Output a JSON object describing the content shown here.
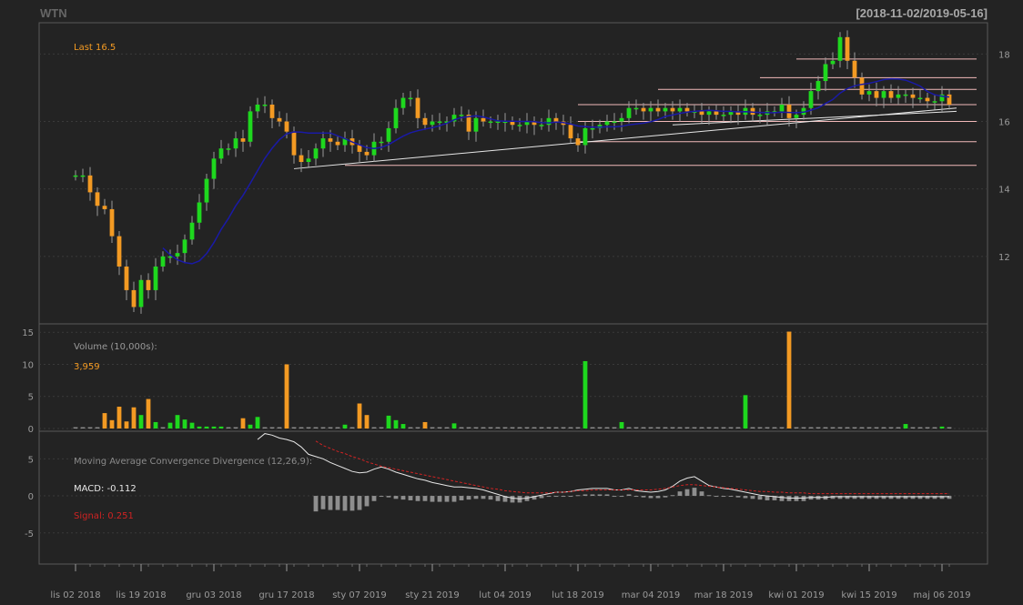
{
  "header": {
    "symbol": "WTN",
    "range": "[2018-11-02/2019-05-16]"
  },
  "colors": {
    "background": "#232323",
    "up": "#1ed81e",
    "down": "#f39a23",
    "ma": "#1a1aa6",
    "level": "#f2b9b9",
    "trend": "#e6e6e6",
    "macd": "#e6e6e6",
    "signal": "#d02323",
    "hist": "#8e8e8e",
    "text": "#9a9a9a",
    "accent": "#f39a23"
  },
  "chart_data": [
    {
      "type": "candlestick",
      "panel": "price",
      "last_label": "Last 16.5",
      "y_ticks": [
        12,
        14,
        16,
        18
      ],
      "ylim": [
        10.0,
        18.9
      ],
      "x_tick_labels": [
        "lis 02 2018",
        "lis 19 2018",
        "gru 03 2018",
        "gru 17 2018",
        "sty 07 2019",
        "sty 21 2019",
        "lut 04 2019",
        "lut 18 2019",
        "mar 04 2019",
        "mar 18 2019",
        "kwi 01 2019",
        "kwi 15 2019",
        "maj 06 2019"
      ],
      "x_tick_index": [
        0,
        9,
        19,
        29,
        39,
        49,
        59,
        69,
        79,
        89,
        99,
        109,
        119
      ],
      "n_bars": 121,
      "close": [
        14.4,
        14.4,
        13.9,
        13.5,
        13.4,
        12.6,
        11.7,
        11.0,
        10.5,
        11.3,
        11.0,
        11.7,
        12.0,
        12.0,
        12.1,
        12.5,
        13.0,
        13.6,
        14.3,
        14.9,
        15.2,
        15.2,
        15.5,
        15.4,
        16.3,
        16.5,
        16.5,
        16.1,
        16.0,
        15.7,
        15.0,
        14.8,
        14.9,
        15.2,
        15.5,
        15.4,
        15.3,
        15.5,
        15.3,
        15.1,
        15.0,
        15.4,
        15.4,
        15.8,
        16.4,
        16.7,
        16.7,
        16.1,
        15.9,
        16.0,
        16.0,
        16.0,
        16.2,
        16.2,
        15.7,
        16.1,
        16.0,
        16.0,
        16.0,
        16.0,
        15.9,
        15.9,
        16.0,
        15.9,
        15.9,
        16.1,
        16.0,
        15.9,
        15.5,
        15.3,
        15.8,
        15.8,
        15.9,
        16.0,
        16.0,
        16.1,
        16.4,
        16.4,
        16.3,
        16.4,
        16.3,
        16.4,
        16.3,
        16.4,
        16.3,
        16.3,
        16.2,
        16.3,
        16.2,
        16.2,
        16.3,
        16.2,
        16.4,
        16.2,
        16.2,
        16.3,
        16.3,
        16.5,
        16.1,
        16.2,
        16.4,
        16.9,
        17.2,
        17.7,
        17.8,
        18.5,
        17.8,
        17.3,
        16.8,
        16.9,
        16.7,
        16.9,
        16.7,
        16.8,
        16.8,
        16.7,
        16.7,
        16.6,
        16.6,
        16.8,
        16.5
      ],
      "ma_window": 12,
      "ma_start_index": 12,
      "support_resistance": [
        {
          "level": 17.85,
          "from_index": 99,
          "to_index": 120
        },
        {
          "level": 17.3,
          "from_index": 94,
          "to_index": 120
        },
        {
          "level": 16.95,
          "from_index": 80,
          "to_index": 120
        },
        {
          "level": 16.5,
          "from_index": 69,
          "to_index": 120
        },
        {
          "level": 16.0,
          "from_index": 69,
          "to_index": 120
        },
        {
          "level": 15.4,
          "from_index": 69,
          "to_index": 120
        },
        {
          "level": 14.7,
          "from_index": 37,
          "to_index": 120
        }
      ],
      "trendlines": [
        {
          "from_index": 30,
          "from_value": 14.6,
          "to_index": 121,
          "to_value": 16.4
        },
        {
          "from_index": 82,
          "from_value": 15.9,
          "to_index": 121,
          "to_value": 16.3
        }
      ]
    },
    {
      "type": "bar",
      "panel": "volume",
      "title": "Volume (10,000s):",
      "last_label": "3,959",
      "y_ticks": [
        0,
        5,
        10,
        15
      ],
      "ylim": [
        0,
        15.6
      ],
      "spikes": [
        {
          "index": 4,
          "value": 2.4
        },
        {
          "index": 5,
          "value": 1.3
        },
        {
          "index": 6,
          "value": 3.4
        },
        {
          "index": 7,
          "value": 1.1
        },
        {
          "index": 8,
          "value": 3.3
        },
        {
          "index": 9,
          "value": 2.1
        },
        {
          "index": 10,
          "value": 4.6
        },
        {
          "index": 11,
          "value": 1.0
        },
        {
          "index": 13,
          "value": 0.9
        },
        {
          "index": 14,
          "value": 2.1
        },
        {
          "index": 15,
          "value": 1.4
        },
        {
          "index": 16,
          "value": 0.9
        },
        {
          "index": 17,
          "value": 0.3
        },
        {
          "index": 18,
          "value": 0.3
        },
        {
          "index": 19,
          "value": 0.3
        },
        {
          "index": 20,
          "value": 0.3
        },
        {
          "index": 23,
          "value": 1.6
        },
        {
          "index": 24,
          "value": 0.6
        },
        {
          "index": 25,
          "value": 1.8
        },
        {
          "index": 29,
          "value": 10.0
        },
        {
          "index": 37,
          "value": 0.6
        },
        {
          "index": 39,
          "value": 3.9
        },
        {
          "index": 40,
          "value": 2.1
        },
        {
          "index": 43,
          "value": 2.0
        },
        {
          "index": 44,
          "value": 1.3
        },
        {
          "index": 45,
          "value": 0.7
        },
        {
          "index": 48,
          "value": 1.0
        },
        {
          "index": 52,
          "value": 0.8
        },
        {
          "index": 70,
          "value": 10.5
        },
        {
          "index": 75,
          "value": 1.0
        },
        {
          "index": 92,
          "value": 5.2
        },
        {
          "index": 98,
          "value": 15.1
        },
        {
          "index": 114,
          "value": 0.7
        },
        {
          "index": 119,
          "value": 0.3
        }
      ],
      "baseline": 0.2
    },
    {
      "type": "line",
      "panel": "macd",
      "title": "Moving Average Convergence Divergence (12,26,9):",
      "macd_label": "MACD: -0.112",
      "signal_label": "Signal: 0.251",
      "y_ticks": [
        -5,
        0,
        5
      ],
      "ylim": [
        -9.2,
        8.6
      ],
      "macd_start_index": 25,
      "signal_start_index": 33,
      "series": [
        {
          "name": "MACD",
          "values": [
            7.6,
            8.4,
            8.2,
            7.8,
            7.6,
            7.3,
            6.6,
            5.6,
            5.3,
            5.0,
            4.5,
            4.1,
            3.7,
            3.3,
            3.1,
            3.2,
            3.6,
            3.9,
            3.6,
            3.2,
            2.9,
            2.6,
            2.3,
            2.1,
            1.8,
            1.6,
            1.4,
            1.2,
            1.2,
            1.1,
            1.0,
            0.8,
            0.5,
            0.2,
            -0.1,
            -0.3,
            -0.4,
            -0.3,
            -0.1,
            0.1,
            0.3,
            0.5,
            0.5,
            0.6,
            0.8,
            0.9,
            1.0,
            1.0,
            1.0,
            0.8,
            0.8,
            1.0,
            0.7,
            0.6,
            0.5,
            0.6,
            0.8,
            1.3,
            2.0,
            2.4,
            2.6,
            2.0,
            1.4,
            1.2,
            1.0,
            0.9,
            0.7,
            0.5,
            0.3,
            0.1,
            0.0,
            -0.1,
            -0.2,
            -0.3,
            -0.3,
            -0.3,
            -0.2,
            -0.2,
            -0.2,
            -0.1,
            -0.1,
            -0.1,
            -0.1,
            -0.1,
            -0.1,
            -0.1,
            -0.1,
            -0.1,
            -0.1,
            -0.1,
            -0.1,
            -0.1,
            -0.1,
            -0.1,
            -0.1,
            -0.1
          ]
        },
        {
          "name": "Signal",
          "values": [
            7.4,
            6.8,
            6.4,
            6.0,
            5.7,
            5.3,
            5.0,
            4.6,
            4.3,
            4.0,
            3.8,
            3.6,
            3.4,
            3.2,
            3.0,
            2.8,
            2.6,
            2.4,
            2.2,
            2.0,
            1.8,
            1.6,
            1.4,
            1.2,
            1.0,
            0.9,
            0.7,
            0.6,
            0.5,
            0.4,
            0.4,
            0.4,
            0.4,
            0.5,
            0.5,
            0.6,
            0.7,
            0.7,
            0.8,
            0.8,
            0.8,
            0.8,
            0.8,
            0.8,
            0.8,
            0.8,
            0.8,
            0.9,
            1.0,
            1.2,
            1.4,
            1.5,
            1.5,
            1.4,
            1.3,
            1.2,
            1.1,
            1.0,
            0.9,
            0.8,
            0.7,
            0.6,
            0.6,
            0.5,
            0.5,
            0.4,
            0.4,
            0.4,
            0.3,
            0.3,
            0.3,
            0.3,
            0.3,
            0.3,
            0.3,
            0.3,
            0.3,
            0.3,
            0.3,
            0.3,
            0.3,
            0.3,
            0.3,
            0.3,
            0.3,
            0.3,
            0.3,
            0.3
          ]
        }
      ]
    }
  ]
}
